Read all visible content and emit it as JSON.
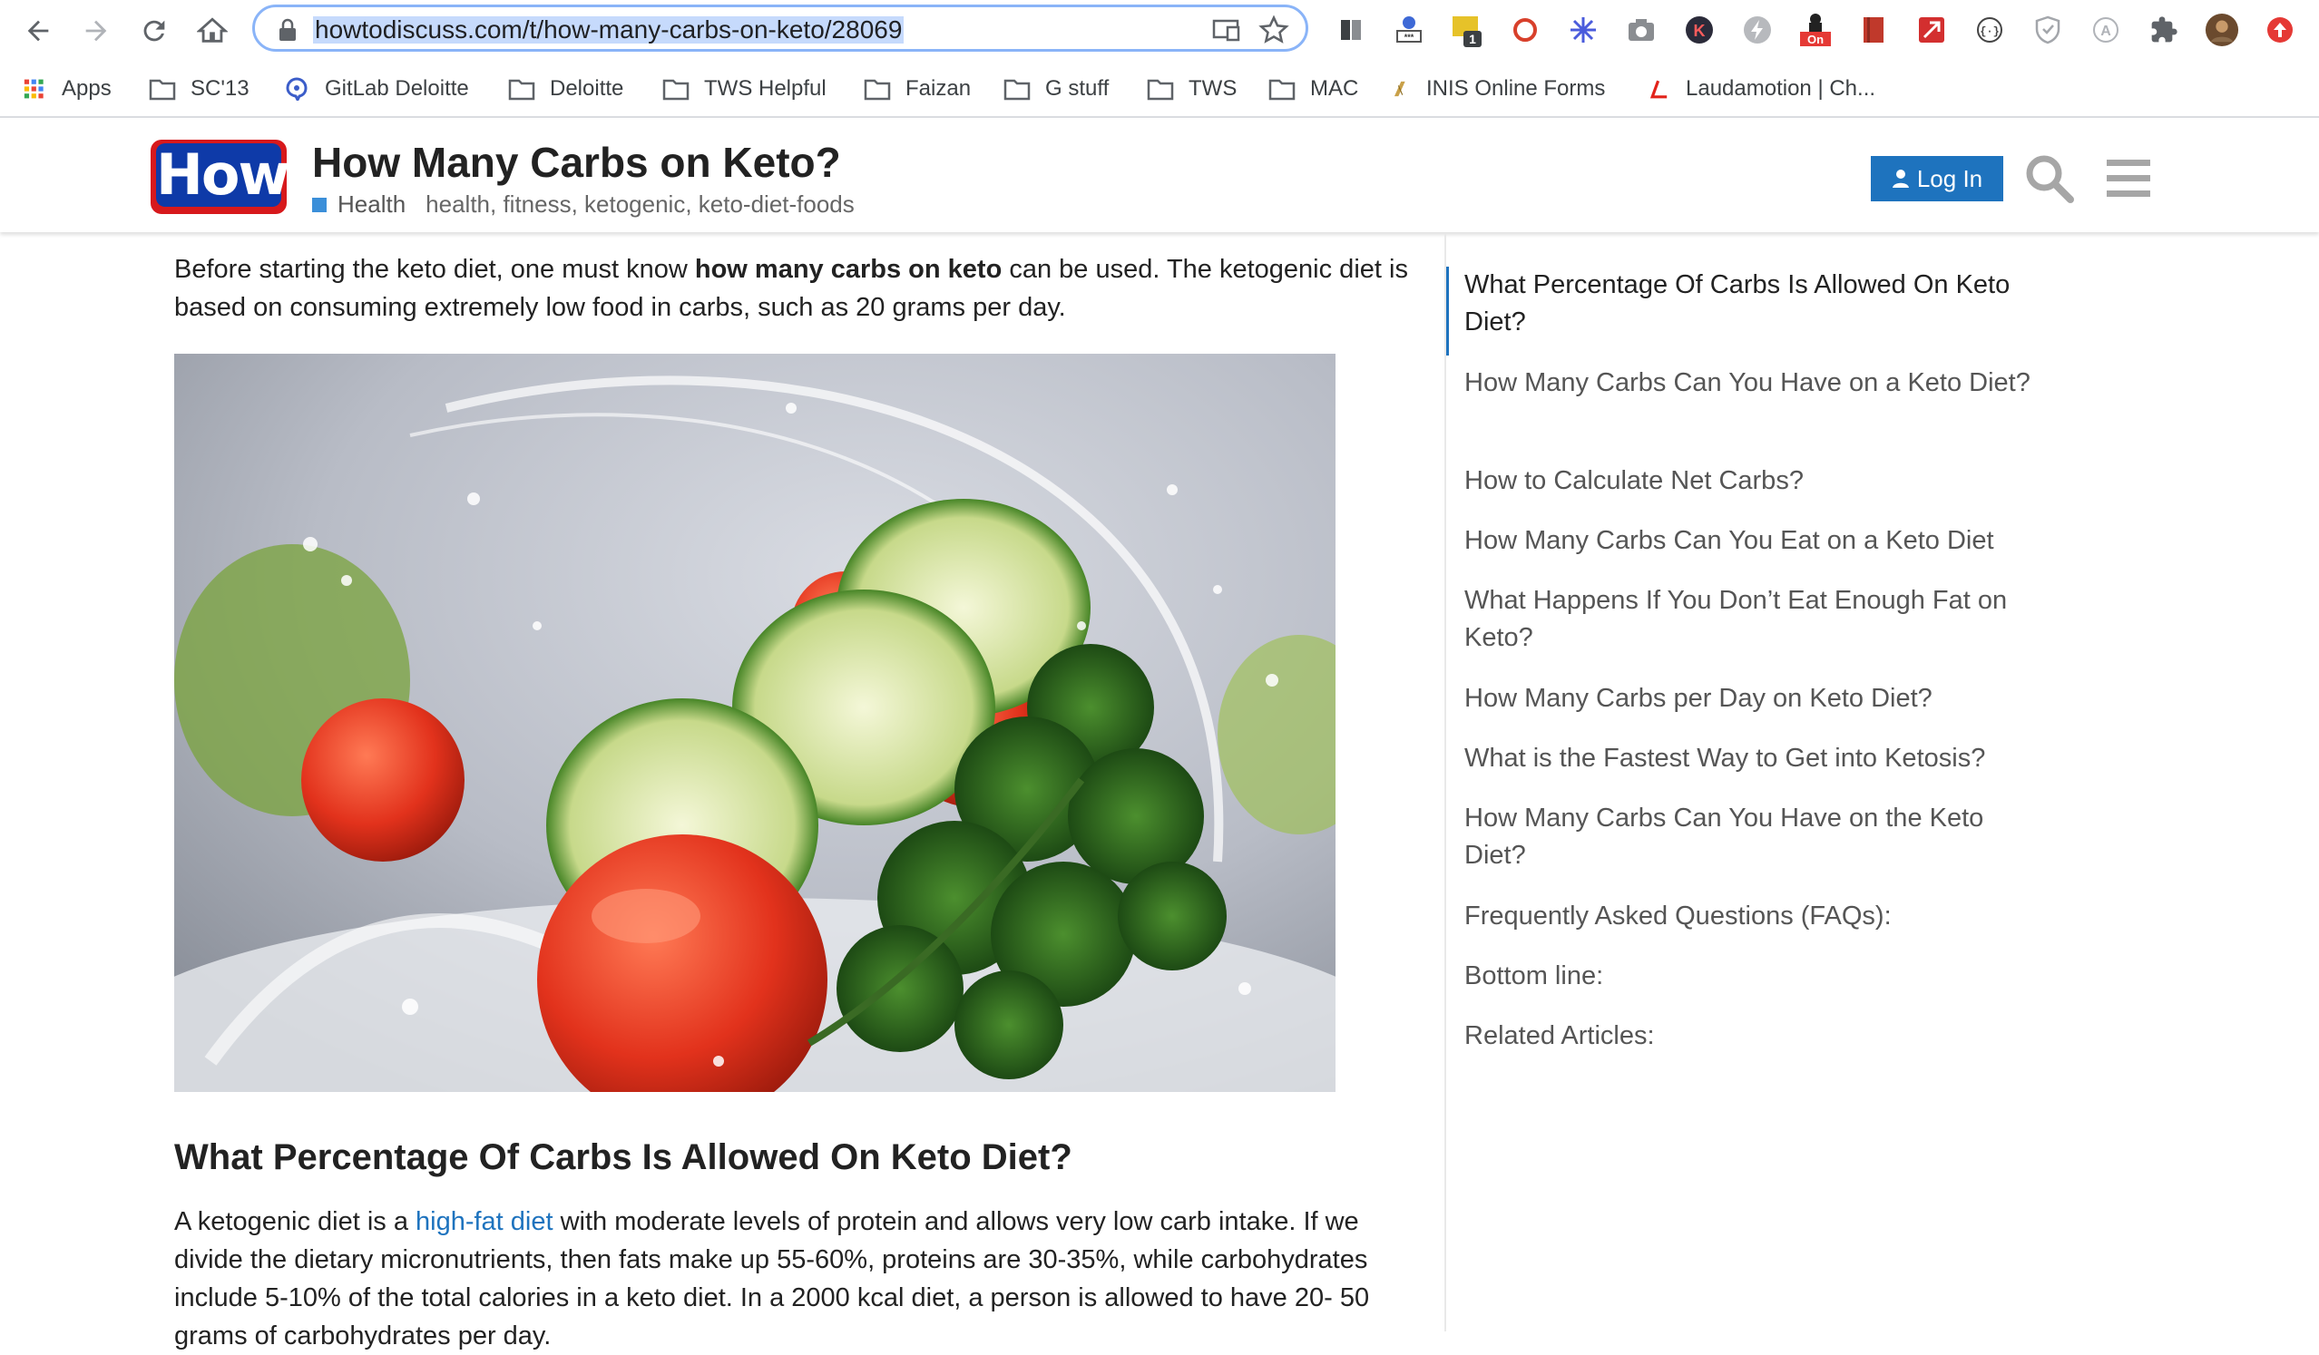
{
  "browser": {
    "url": "howtodiscuss.com/t/how-many-carbs-on-keto/28069",
    "extensions": [
      {
        "name": "kindle-icon",
        "badge": ""
      },
      {
        "name": "password-icon",
        "badge": ""
      },
      {
        "name": "notes-icon",
        "badge": "1"
      },
      {
        "name": "opera-icon",
        "badge": ""
      },
      {
        "name": "snowflake-icon",
        "badge": ""
      },
      {
        "name": "camera-icon",
        "badge": ""
      },
      {
        "name": "k-icon",
        "badge": "K"
      },
      {
        "name": "bolt-icon",
        "badge": ""
      },
      {
        "name": "toggle-on-icon",
        "badge": "On"
      },
      {
        "name": "book-icon",
        "badge": ""
      },
      {
        "name": "pdf-icon",
        "badge": ""
      },
      {
        "name": "code-icon",
        "badge": ""
      },
      {
        "name": "shield-icon",
        "badge": ""
      },
      {
        "name": "translate-icon",
        "badge": ""
      },
      {
        "name": "puzzle-icon",
        "badge": ""
      },
      {
        "name": "profile-avatar",
        "badge": ""
      },
      {
        "name": "update-icon",
        "badge": ""
      }
    ]
  },
  "bookmarks": [
    {
      "label": "Apps",
      "icon": "apps-grid-icon"
    },
    {
      "label": "SC'13",
      "icon": "folder-icon"
    },
    {
      "label": "GitLab Deloitte",
      "icon": "gitlab-icon"
    },
    {
      "label": "Deloitte",
      "icon": "folder-icon"
    },
    {
      "label": "TWS Helpful",
      "icon": "folder-icon"
    },
    {
      "label": "Faizan",
      "icon": "folder-icon"
    },
    {
      "label": "G stuff",
      "icon": "folder-icon"
    },
    {
      "label": "TWS",
      "icon": "folder-icon"
    },
    {
      "label": "MAC",
      "icon": "folder-icon"
    },
    {
      "label": "INIS Online Forms",
      "icon": "harp-icon"
    },
    {
      "label": "Laudamotion | Ch...",
      "icon": "laudamotion-icon"
    }
  ],
  "site": {
    "logo_text": "How",
    "title": "How Many Carbs on Keto?",
    "category": "Health",
    "tags": "health, fitness, ketogenic, keto-diet-foods",
    "login_label": "Log In",
    "accent_color": "#1e73be",
    "category_color": "#3b8fd9"
  },
  "article": {
    "intro_before": "Before starting the keto diet, one must know ",
    "intro_bold": "how many carbs on keto",
    "intro_after": " can be used. The ketogenic diet is based on consuming extremely low food in carbs, such as 20 grams per day.",
    "section_heading": "What Percentage Of Carbs Is Allowed On Keto Diet?",
    "para_before": "A ketogenic diet is a ",
    "para_link": "high-fat diet",
    "para_after": " with moderate levels of protein and allows very low carb intake. If we divide the dietary micronutrients, then fats make up 55-60%, proteins are 30-35%, while carbohydrates include 5-10% of the total calories in a keto diet. In a 2000 kcal diet, a person is allowed to have 20- 50 grams of carbohydrates per day."
  },
  "toc": [
    "What Percentage Of Carbs Is Allowed On Keto Diet?",
    "How Many Carbs Can You Have on a Keto Diet?",
    "How to Calculate Net Carbs?",
    "How Many Carbs Can You Eat on a Keto Diet",
    "What Happens If You Don’t Eat Enough Fat on Keto?",
    "How Many Carbs per Day on Keto Diet?",
    "What is the Fastest Way to Get into Ketosis?",
    "How Many Carbs Can You Have on the Keto Diet?",
    "Frequently Asked Questions (FAQs):",
    "Bottom line:",
    "Related Articles:"
  ]
}
